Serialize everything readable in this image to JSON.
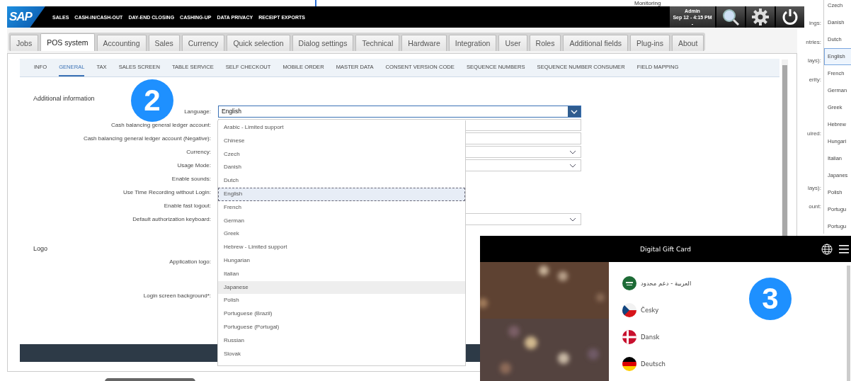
{
  "background_window": {
    "partial_heading": "Monitoring",
    "labels": [
      "ings:",
      "ntries:",
      "lays):",
      "erity:",
      "uired:",
      "lays):",
      "ount:"
    ],
    "language_list": [
      {
        "label": "Czech",
        "selected": false
      },
      {
        "label": "Danish",
        "selected": false
      },
      {
        "label": "Dutch",
        "selected": false
      },
      {
        "label": "English",
        "selected": true
      },
      {
        "label": "French",
        "selected": false
      },
      {
        "label": "German",
        "selected": false
      },
      {
        "label": "Greek",
        "selected": false
      },
      {
        "label": "Hebrew",
        "selected": false
      },
      {
        "label": "Hungari",
        "selected": false
      },
      {
        "label": "Italian",
        "selected": false
      },
      {
        "label": "Japanes",
        "selected": false
      },
      {
        "label": "Polish",
        "selected": false
      },
      {
        "label": "Portugu",
        "selected": false
      },
      {
        "label": "Portugu",
        "selected": false
      }
    ]
  },
  "pos_window": {
    "logo": "SAP",
    "app_menu": [
      "SALES",
      "CASH-IN/CASH-OUT",
      "DAY-END CLOSING",
      "CASHING-UP",
      "DATA PRIVACY",
      "RECEIPT EXPORTS"
    ],
    "user": {
      "name": "Admin",
      "datetime": "Sep 12 - 4:15 PM",
      "extra": "-"
    },
    "tabs": [
      {
        "label": "Jobs",
        "selected": false
      },
      {
        "label": "POS system",
        "selected": true
      },
      {
        "label": "Accounting",
        "selected": false
      },
      {
        "label": "Sales",
        "selected": false
      },
      {
        "label": "Currency",
        "selected": false
      },
      {
        "label": "Quick selection",
        "selected": false
      },
      {
        "label": "Dialog settings",
        "selected": false
      },
      {
        "label": "Technical",
        "selected": false
      },
      {
        "label": "Hardware",
        "selected": false
      },
      {
        "label": "Integration",
        "selected": false
      },
      {
        "label": "User",
        "selected": false
      },
      {
        "label": "Roles",
        "selected": false
      },
      {
        "label": "Additional fields",
        "selected": false
      },
      {
        "label": "Plug-ins",
        "selected": false
      },
      {
        "label": "About",
        "selected": false
      }
    ],
    "subtabs": [
      {
        "label": "INFO",
        "selected": false
      },
      {
        "label": "GENERAL",
        "selected": true
      },
      {
        "label": "TAX",
        "selected": false
      },
      {
        "label": "SALES SCREEN",
        "selected": false
      },
      {
        "label": "TABLE SERVICE",
        "selected": false
      },
      {
        "label": "SELF CHECKOUT",
        "selected": false
      },
      {
        "label": "MOBILE ORDER",
        "selected": false
      },
      {
        "label": "MASTER DATA",
        "selected": false
      },
      {
        "label": "CONSENT VERSION CODE",
        "selected": false
      },
      {
        "label": "SEQUENCE NUMBERS",
        "selected": false
      },
      {
        "label": "SEQUENCE NUMBER CONSUMER",
        "selected": false
      },
      {
        "label": "FIELD MAPPING",
        "selected": false
      }
    ],
    "sections": [
      {
        "title": "Additional information",
        "fields": [
          {
            "label": "Language:",
            "kind": "open-select",
            "value": "English"
          },
          {
            "label": "Cash balancing general ledger account:",
            "kind": "text"
          },
          {
            "label": "Cash balancing general ledger account (Negative):",
            "kind": "text"
          },
          {
            "label": "Currency:",
            "kind": "select"
          },
          {
            "label": "Usage Mode:",
            "kind": "select"
          },
          {
            "label": "Enable sounds:",
            "kind": "covered"
          },
          {
            "label": "Use Time Recording without Login:",
            "kind": "covered"
          },
          {
            "label": "Enable fast logout:",
            "kind": "covered"
          },
          {
            "label": "Default authorization keyboard:",
            "kind": "select"
          }
        ]
      },
      {
        "title": "Logo",
        "fields": [
          {
            "label": "Application logo:",
            "kind": "tall"
          },
          {
            "label": "Login screen background*:",
            "kind": "covered"
          }
        ]
      }
    ],
    "language_dropdown": [
      {
        "label": "Arabic - Limited support",
        "selected": false,
        "hovered": false
      },
      {
        "label": "Chinese",
        "selected": false,
        "hovered": false
      },
      {
        "label": "Czech",
        "selected": false,
        "hovered": false
      },
      {
        "label": "Danish",
        "selected": false,
        "hovered": false
      },
      {
        "label": "Dutch",
        "selected": false,
        "hovered": false
      },
      {
        "label": "English",
        "selected": true,
        "hovered": false
      },
      {
        "label": "French",
        "selected": false,
        "hovered": false
      },
      {
        "label": "German",
        "selected": false,
        "hovered": false
      },
      {
        "label": "Greek",
        "selected": false,
        "hovered": false
      },
      {
        "label": "Hebrew - Limited support",
        "selected": false,
        "hovered": false
      },
      {
        "label": "Hungarian",
        "selected": false,
        "hovered": false
      },
      {
        "label": "Italian",
        "selected": false,
        "hovered": false
      },
      {
        "label": "Japanese",
        "selected": false,
        "hovered": true
      },
      {
        "label": "Polish",
        "selected": false,
        "hovered": false
      },
      {
        "label": "Portuguese (Brazil)",
        "selected": false,
        "hovered": false
      },
      {
        "label": "Portuguese (Portugal)",
        "selected": false,
        "hovered": false
      },
      {
        "label": "Russian",
        "selected": false,
        "hovered": false
      },
      {
        "label": "Slovak",
        "selected": false,
        "hovered": false
      }
    ],
    "badge": "2"
  },
  "gift_card": {
    "title": "Digital Gift Card",
    "badge": "3",
    "languages": [
      {
        "label": "العربية - دعم محدود",
        "kind": "sa"
      },
      {
        "label": "Česky",
        "kind": "cz"
      },
      {
        "label": "Dansk",
        "kind": "dk"
      },
      {
        "label": "Deutsch",
        "kind": "de"
      }
    ]
  }
}
